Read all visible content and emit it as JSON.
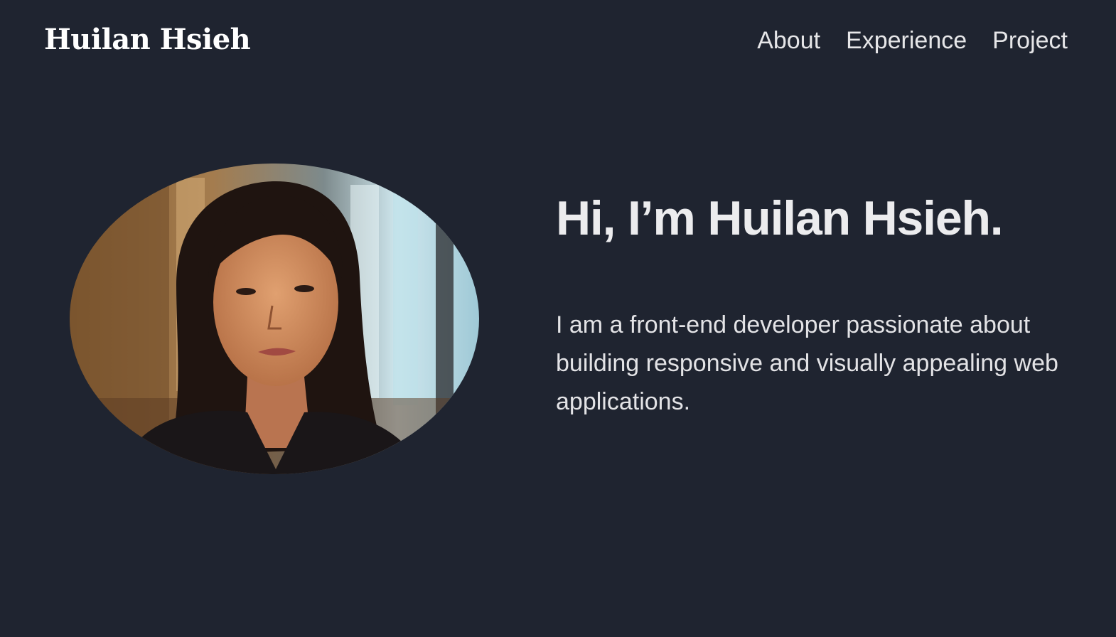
{
  "header": {
    "brand": "Huilan Hsieh",
    "nav": [
      {
        "label": "About"
      },
      {
        "label": "Experience"
      },
      {
        "label": "Project"
      }
    ]
  },
  "hero": {
    "title": "Hi, I’m Huilan Hsieh.",
    "description": "I am a front-end developer passionate about building responsive and visually appealing web applications."
  },
  "colors": {
    "background": "#1f2430",
    "text": "#e8e8ea"
  }
}
